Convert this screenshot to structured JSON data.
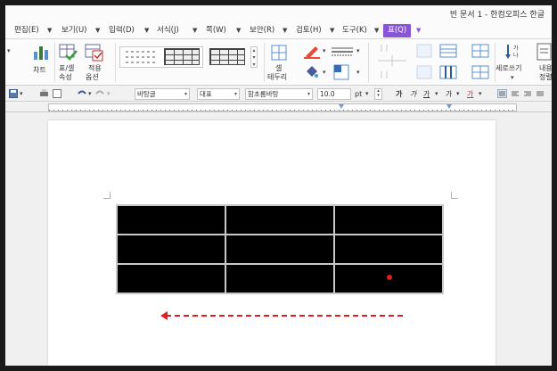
{
  "window": {
    "title": "빈 문서 1 - 한컴오피스 한글"
  },
  "menu": [
    {
      "label": "편집(E)",
      "active": false
    },
    {
      "label": "보기(U)",
      "active": false
    },
    {
      "label": "입력(D)",
      "active": false
    },
    {
      "label": "서식(J)",
      "active": false
    },
    {
      "label": "쪽(W)",
      "active": false
    },
    {
      "label": "보안(R)",
      "active": false
    },
    {
      "label": "검토(H)",
      "active": false
    },
    {
      "label": "도구(K)",
      "active": false
    },
    {
      "label": "표(Q)",
      "active": true
    }
  ],
  "ribbon": {
    "chart_label": "차트",
    "table_cell_props_line1": "표/셀",
    "table_cell_props_line2": "속성",
    "apply_options_line1": "적용",
    "apply_options_line2": "옵션",
    "cell_border_line1": "셀",
    "cell_border_line2": "테두리",
    "vertical_writing_label": "세로쓰기",
    "content_align_line1": "내용",
    "content_align_line2": "정렬"
  },
  "format_bar": {
    "style": "바탕글",
    "language": "대표",
    "font": "함초롬바탕",
    "size": "10.0",
    "unit": "pt",
    "bold": "가",
    "italic": "가",
    "underline": "가",
    "strike": "가",
    "color": "가"
  },
  "table": {
    "rows": 3,
    "cols": 3
  },
  "colors": {
    "accent": "#8a54d6",
    "annotation": "#e02020",
    "cell_fill": "#000000"
  }
}
